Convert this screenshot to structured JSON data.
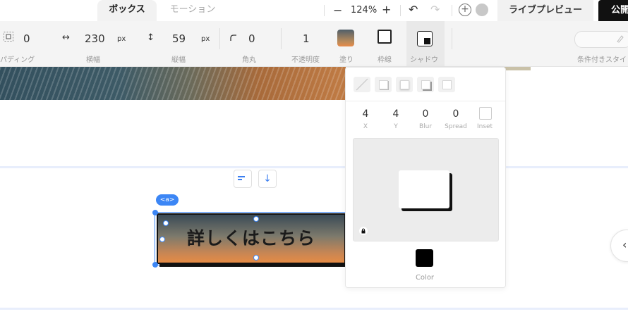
{
  "tabs": [
    {
      "label": "ボックス",
      "active": true
    },
    {
      "label": "モーション",
      "active": false
    }
  ],
  "toolbar": {
    "zoom_out": "−",
    "zoom": "124%",
    "zoom_in": "+",
    "undo": "↶",
    "redo": "↷",
    "add": "+",
    "preview_label": "ライブプレビュー",
    "publish_label": "公開"
  },
  "properties": {
    "padding": {
      "value": "0",
      "label": "パディング"
    },
    "width": {
      "value": "230",
      "unit": "px",
      "label": "横幅"
    },
    "height": {
      "value": "59",
      "unit": "px",
      "label": "縦幅"
    },
    "radius": {
      "value": "0",
      "label": "角丸"
    },
    "opacity": {
      "value": "1",
      "label": "不透明度"
    },
    "fill": {
      "label": "塗り"
    },
    "border": {
      "label": "枠線"
    },
    "shadow": {
      "label": "シャドウ"
    },
    "conditional_style": {
      "label": "条件付きスタイ"
    }
  },
  "canvas": {
    "tag_label": "<a>",
    "button_text": "詳しくはこちら"
  },
  "shadow_panel": {
    "presets": [
      "none",
      "small",
      "medium",
      "large",
      "outline"
    ],
    "fields": [
      {
        "value": "4",
        "label": "X"
      },
      {
        "value": "4",
        "label": "Y"
      },
      {
        "value": "0",
        "label": "Blur"
      },
      {
        "value": "0",
        "label": "Spread"
      }
    ],
    "inset_label": "Inset",
    "color_label": "Color",
    "color": "#000000"
  },
  "colors": {
    "accent": "#3c86f5",
    "publish_bg": "#111111"
  }
}
